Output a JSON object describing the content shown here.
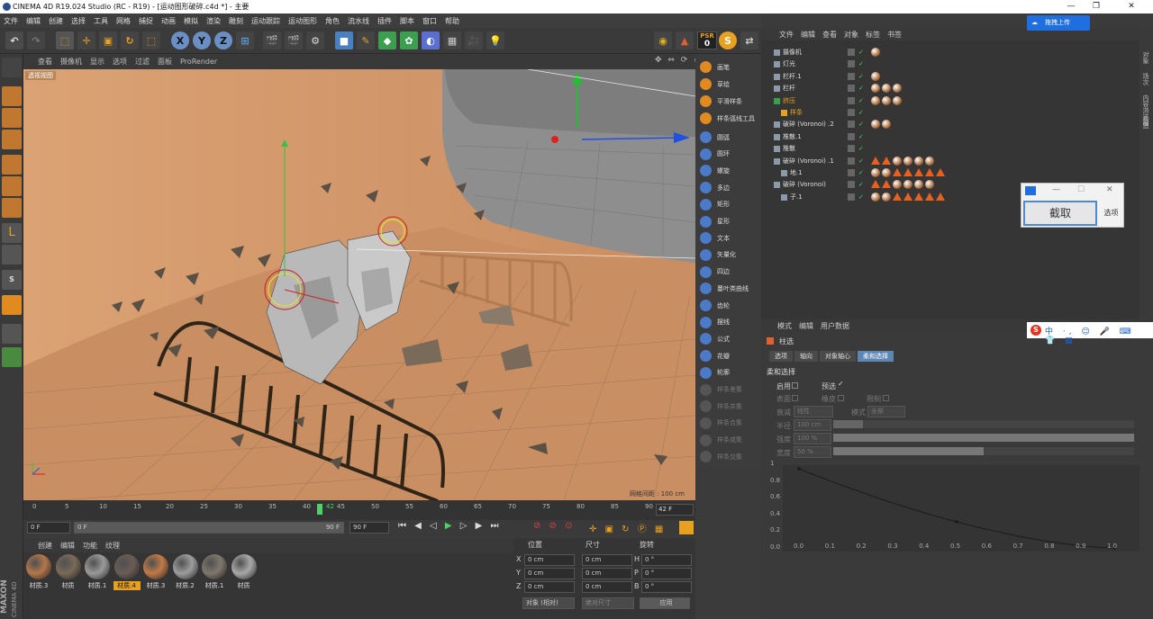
{
  "window": {
    "title": "CINEMA 4D R19.024 Studio (RC - R19) - [运动图形破碎.c4d *] - 主要"
  },
  "menu": [
    "文件",
    "编辑",
    "创建",
    "选择",
    "工具",
    "网格",
    "捕捉",
    "动画",
    "模拟",
    "渲染",
    "雕刻",
    "运动跟踪",
    "运动图形",
    "角色",
    "流水线",
    "插件",
    "脚本",
    "窗口",
    "帮助"
  ],
  "psr": {
    "label": "PSR",
    "value": "0"
  },
  "viewport": {
    "menu": [
      "查看",
      "摄像机",
      "显示",
      "选项",
      "过滤",
      "面板",
      "ProRender"
    ],
    "camera_label": "透视视图",
    "grid_label": "网格间距 : 100 cm"
  },
  "spline_palette": {
    "items": [
      "画笔",
      "草绘",
      "平滑样条",
      "样条弧线工具",
      "圆弧",
      "圆环",
      "螺旋",
      "多边",
      "矩形",
      "星形",
      "文本",
      "矢量化",
      "四边",
      "蔓叶类曲线",
      "齿轮",
      "摆线",
      "公式",
      "花瓣",
      "轮廓",
      "样条差集",
      "样条并集",
      "样条合集",
      "样条或集",
      "样条交集"
    ]
  },
  "timeline": {
    "ticks": [
      "0",
      "5",
      "10",
      "15",
      "20",
      "25",
      "30",
      "35",
      "40",
      "42",
      "45",
      "50",
      "55",
      "60",
      "65",
      "70",
      "75",
      "80",
      "85",
      "90"
    ],
    "current_frame": "42",
    "end_label": "42 F"
  },
  "transport": {
    "start_field": "0 F",
    "start_range": "0 F",
    "end_range": "90 F",
    "end_field": "90 F"
  },
  "material_manager": {
    "menu": [
      "创建",
      "编辑",
      "功能",
      "纹理"
    ],
    "materials": [
      {
        "name": "材质.3",
        "color": "#b3774a"
      },
      {
        "name": "材质",
        "color": "#7a6a57"
      },
      {
        "name": "材质.1",
        "color": "#9a9a9a"
      },
      {
        "name": "材质.4",
        "color": "#6a5d55"
      },
      {
        "name": "材质.3",
        "color": "#c07a47"
      },
      {
        "name": "材质.2",
        "color": "#9d9d9d"
      },
      {
        "name": "材质.1",
        "color": "#7e776c"
      },
      {
        "name": "材质",
        "color": "#a8a8a8"
      }
    ]
  },
  "coordinates": {
    "headers": [
      "位置",
      "尺寸",
      "旋转"
    ],
    "rows": [
      {
        "a": "X",
        "pos": "0 cm",
        "size": "0 cm",
        "r": "H",
        "rot": "0 °"
      },
      {
        "a": "Y",
        "pos": "0 cm",
        "size": "0 cm",
        "r": "P",
        "rot": "0 °"
      },
      {
        "a": "Z",
        "pos": "0 cm",
        "size": "0 cm",
        "r": "B",
        "rot": "0 °"
      }
    ],
    "mode_select": "对象 (相对)",
    "size_select": "绝对尺寸",
    "apply_button": "应用"
  },
  "object_manager": {
    "menu": [
      "文件",
      "编辑",
      "查看",
      "对象",
      "标签",
      "书签"
    ],
    "objects": [
      "摄像机",
      "灯光",
      "栏杆.1",
      "栏杆",
      "挤压",
      "样条",
      "破碎 (Voronoi) .2",
      "推散.1",
      "推散",
      "破碎 (Voronoi) .1",
      "地.1",
      "破碎 (Voronoi)",
      "子.1"
    ]
  },
  "side_tabs": [
    "对象",
    "场次",
    "内容浏览器",
    "构造"
  ],
  "cloud_button": "拖拽上传",
  "popup": {
    "capture": "截取",
    "options": "选项"
  },
  "attributes": {
    "menu": [
      "模式",
      "编辑",
      "用户数据"
    ],
    "object_name": "柱选",
    "tabs": [
      "选项",
      "轴向",
      "对象轴心",
      "柔和选择"
    ],
    "section": "柔和选择",
    "enable_label": "启用",
    "preview_label": "预选",
    "surface_label": "表面",
    "rubber_label": "橡皮",
    "limit_label": "限制",
    "falloff_label": "衰减",
    "falloff_value": "线性",
    "mode_label": "模式",
    "mode_value": "全部",
    "radius_label": "半径",
    "radius_value": "100 cm",
    "strength_label": "强度",
    "strength_value": "100 %",
    "width_label": "宽度",
    "width_value": "50 %",
    "graph_y": [
      "1",
      "0.8",
      "0.6",
      "0.4",
      "0.2",
      "0.0"
    ],
    "graph_x": [
      "0.0",
      "0.1",
      "0.2",
      "0.3",
      "0.4",
      "0.5",
      "0.6",
      "0.7",
      "0.8",
      "0.9",
      "1.0"
    ]
  },
  "brand": {
    "maxon": "MAXON",
    "product": "CINEMA 4D"
  }
}
